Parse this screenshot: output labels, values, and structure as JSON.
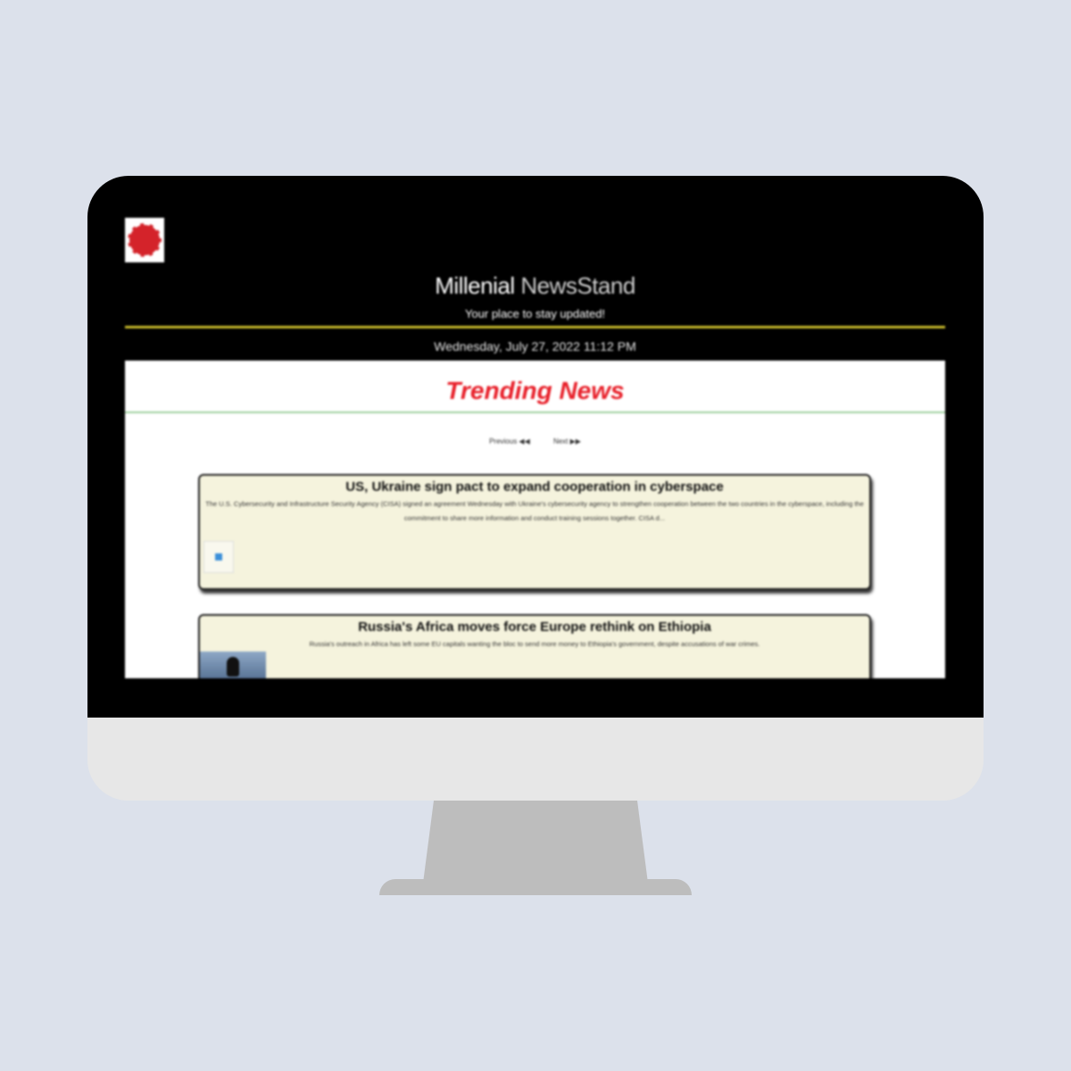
{
  "site": {
    "title_part1": "Millenial",
    "title_part2": "NewsStand",
    "tagline": "Your place to stay updated!",
    "datetime": "Wednesday, July 27, 2022 11:12 PM"
  },
  "section": {
    "title": "Trending News"
  },
  "pager": {
    "previous_label": "Previous ◀◀",
    "next_label": "Next ▶▶"
  },
  "articles": [
    {
      "title": "US, Ukraine sign pact to expand cooperation in cyberspace",
      "summary": "The U.S. Cybersecurity and Infrastructure Security Agency (CISA) signed an agreement Wednesday with Ukraine's cybersecurity agency to strengthen cooperation between the two countries in the cyberspace, including the commitment to share more information and conduct training sessions together. CISA d..."
    },
    {
      "title": "Russia's Africa moves force Europe rethink on Ethiopia",
      "summary": "Russia's outreach in Africa has left some EU capitals wanting the bloc to send more money to Ethiopia's government, despite accusations of war crimes."
    }
  ],
  "colors": {
    "background": "#dce1eb",
    "header": "#000000",
    "accent_line": "#c3b62a",
    "section_title": "#e8202a",
    "card": "#f5f3dd"
  }
}
